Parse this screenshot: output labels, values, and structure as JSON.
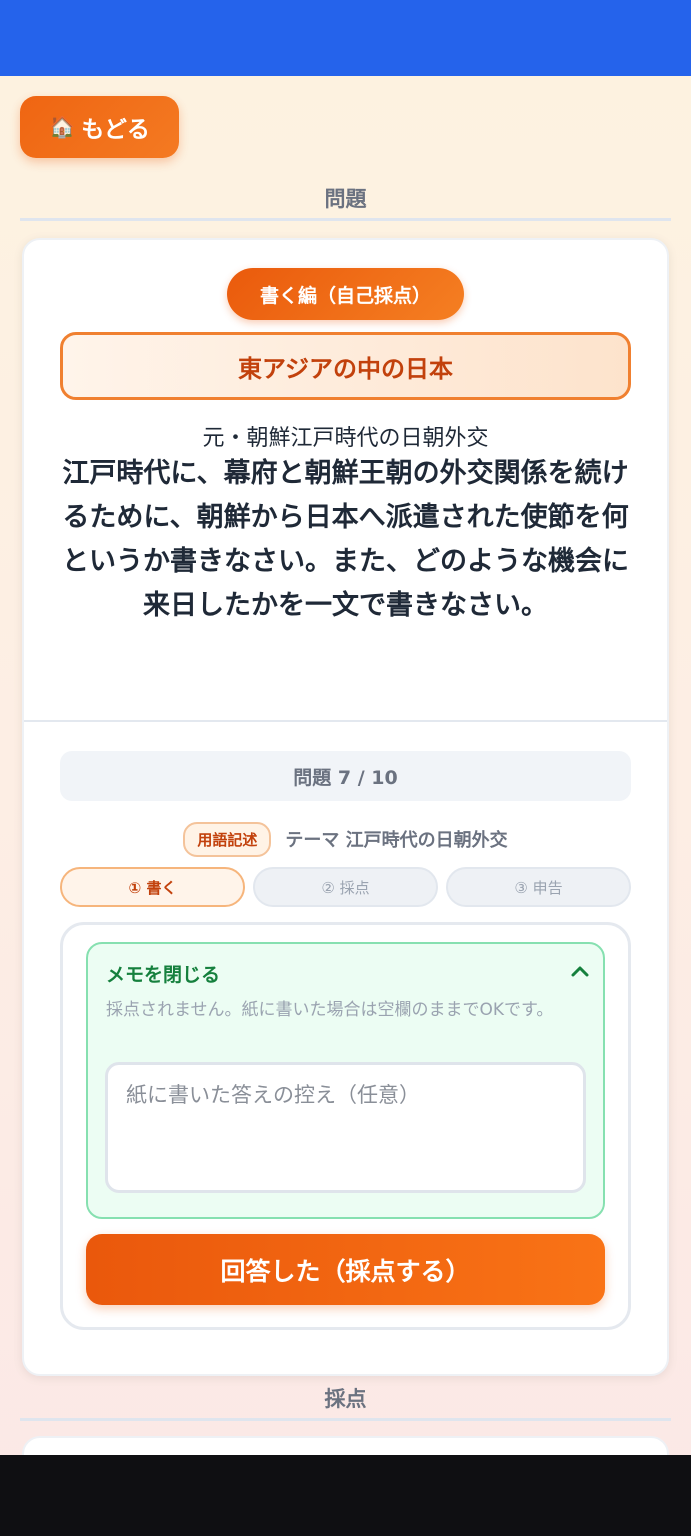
{
  "nav": {
    "back_label": "もどる",
    "back_icon": "home-icon"
  },
  "sections": {
    "question_heading": "問題",
    "grading_heading": "採点"
  },
  "question": {
    "mode": "書く編（自己採点）",
    "unit": "東アジアの中の日本",
    "subtopic": "元・朝鮮江戸時代の日朝外交",
    "text": "江戸時代に、幕府と朝鮮王朝の外交関係を続けるために、朝鮮から日本へ派遣された使節を何というか書きなさい。また、どのような機会に来日したかを一文で書きなさい。"
  },
  "progress": {
    "counter_label": "問題 7 / 10"
  },
  "meta": {
    "type_badge": "用語記述",
    "theme": "テーマ 江戸時代の日朝外交"
  },
  "steps": [
    {
      "label": "① 書く",
      "active": true
    },
    {
      "label": "② 採点",
      "active": false
    },
    {
      "label": "③ 申告",
      "active": false
    }
  ],
  "memo": {
    "toggle_label": "メモを閉じる",
    "note": "採点されません。紙に書いた場合は空欄のままでOKです。",
    "placeholder": "紙に書いた答えの控え（任意）",
    "value": ""
  },
  "submit": {
    "label": "回答した（採点する）"
  },
  "colors": {
    "topbar": "#2563eb",
    "accent": "#ea580c",
    "memo_green": "#15803d"
  }
}
